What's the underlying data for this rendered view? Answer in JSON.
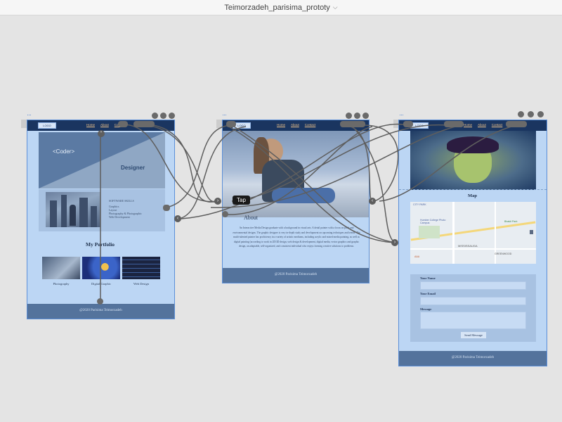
{
  "window": {
    "title": "Teimorzadeh_parisima_prototy"
  },
  "board1": {
    "logo": "LOGO",
    "nav": [
      "Home",
      "About",
      "Contact"
    ],
    "hero_coder": "<Coder>",
    "hero_designer": "Designer",
    "skills_title": "SOFTWARE SKILLS",
    "skills": [
      "Graphics",
      "Layout",
      "Photography & Photographic",
      "Web Development"
    ],
    "portfolio_title": "My Portfolio",
    "thumbs": [
      "Photography",
      "Digital Graphic",
      "Web Design"
    ],
    "footer": "@2020 Parisima Teimorzadeh"
  },
  "board2": {
    "logo": "LOGO",
    "nav": [
      "Home",
      "About",
      "Contact"
    ],
    "about_title": "About",
    "about_text": "An Interactive Media Design graduate with a background in visual arts. A detail painter with a focus on pitch and environmental designs. The graphic designer is very in-depth study and development on upcoming techniques and trends. The multi-talented painter has proficiency in a variety of artistic mediums, including acrylic and mixed media painting, as well as digital painting (according to work in 2D/3D design, web design & development, digital media, vector graphics and graphic design, an adaptable, self-organized, and consistent individual who enjoys forming creative solutions to problems.",
    "footer": "@2020 Parisima Teimorzadeh"
  },
  "board3": {
    "logo": "LOGO",
    "nav": [
      "Home",
      "About",
      "Contact"
    ],
    "map_title": "Map",
    "map_labels": [
      "CITY PARK",
      "Humber College Photo Campus",
      "MISSISSAUGA",
      "GREENWOOD",
      "Bhakti Park",
      "AAA"
    ],
    "form_labels": [
      "Your Name",
      "Your Email",
      "Message"
    ],
    "send_label": "Send Message",
    "footer": "@2020 Parisima Teimorzadeh"
  },
  "tap_label": "Tap",
  "colors": {
    "artboard": "#bcd6f4",
    "nav": "#1a3560",
    "footer": "#54739c",
    "wire": "#5e5e5e",
    "selection": "#5b8fd8"
  }
}
